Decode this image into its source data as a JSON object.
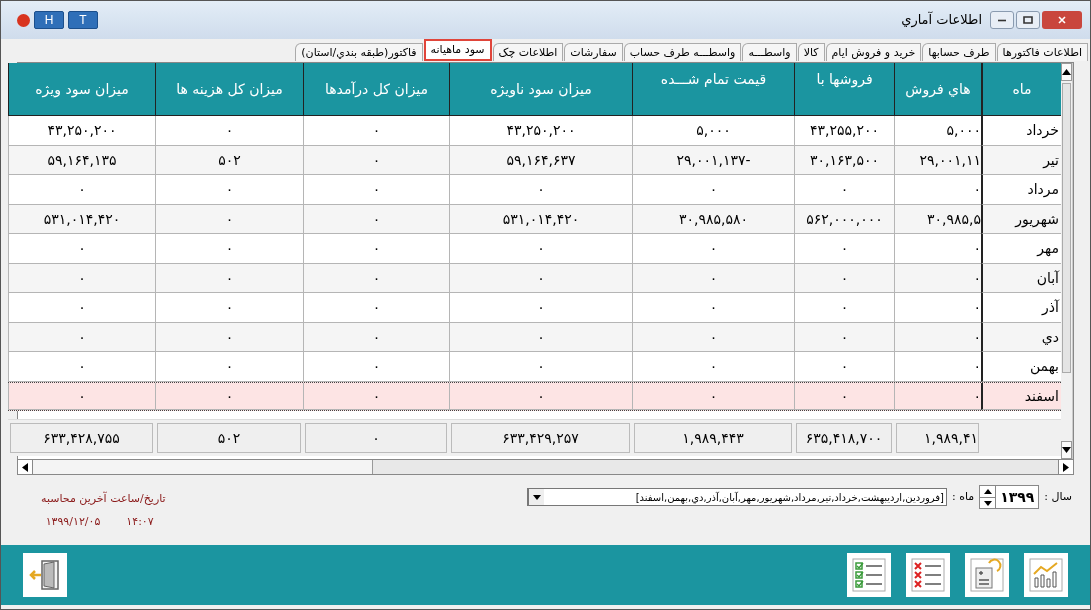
{
  "window": {
    "title": "اطلاعات آماري",
    "title_buttons": [
      "T",
      "H"
    ]
  },
  "tabs": [
    {
      "label": "اطلاعات فاکتورها",
      "selected": false
    },
    {
      "label": "طرف حسابها",
      "selected": false
    },
    {
      "label": "خريد و فروش ايام",
      "selected": false
    },
    {
      "label": "کالا",
      "selected": false
    },
    {
      "label": "واسطـــه",
      "selected": false
    },
    {
      "label": "واسطـــه طرف حساب",
      "selected": false
    },
    {
      "label": "سفارشات",
      "selected": false
    },
    {
      "label": "اطلاعات چک",
      "selected": false
    },
    {
      "label": "سود ماهيانه",
      "selected": true
    },
    {
      "label": "فاکتور(طبقه بندي/استان)",
      "selected": false
    }
  ],
  "table": {
    "columns": [
      {
        "label": "ماه",
        "second_line_hidden": false
      },
      {
        "label": "هاي فروش",
        "second_line_hidden": false
      },
      {
        "label": "فروشها با",
        "second_line_hidden": true
      },
      {
        "label": "قيمت تمام شـــده",
        "second_line_hidden": true
      },
      {
        "label": "ميزان سود ناويژه",
        "second_line_hidden": false
      },
      {
        "label": "ميزان کل درآمدها",
        "second_line_hidden": false
      },
      {
        "label": "ميزان کل هزينه ها",
        "second_line_hidden": false
      },
      {
        "label": "ميزان سود ويژه",
        "second_line_hidden": false
      }
    ],
    "rows": [
      {
        "selected": false,
        "cells": [
          "خرداد",
          "۵,۰۰۰",
          "۴۳,۲۵۵,۲۰۰",
          "۵,۰۰۰",
          "۴۳,۲۵۰,۲۰۰",
          "۰",
          "۰",
          "۴۳,۲۵۰,۲۰۰"
        ]
      },
      {
        "selected": false,
        "cells": [
          "تير",
          "۲۹,۰۰۱,۱۱",
          "۳۰,۱۶۳,۵۰۰",
          "۲۹,۰۰۱,۱۳۷-",
          "۵۹,۱۶۴,۶۳۷",
          "۰",
          "۵۰۲",
          "۵۹,۱۶۴,۱۳۵"
        ]
      },
      {
        "selected": false,
        "cells": [
          "مرداد",
          "۰",
          "۰",
          "۰",
          "۰",
          "۰",
          "۰",
          "۰"
        ]
      },
      {
        "selected": false,
        "cells": [
          "شهريور",
          "۳۰,۹۸۵,۵",
          "۵۶۲,۰۰۰,۰۰۰",
          "۳۰,۹۸۵,۵۸۰",
          "۵۳۱,۰۱۴,۴۲۰",
          "۰",
          "۰",
          "۵۳۱,۰۱۴,۴۲۰"
        ]
      },
      {
        "selected": false,
        "cells": [
          "مهر",
          "۰",
          "۰",
          "۰",
          "۰",
          "۰",
          "۰",
          "۰"
        ]
      },
      {
        "selected": false,
        "cells": [
          "آبان",
          "۰",
          "۰",
          "۰",
          "۰",
          "۰",
          "۰",
          "۰"
        ]
      },
      {
        "selected": false,
        "cells": [
          "آذر",
          "۰",
          "۰",
          "۰",
          "۰",
          "۰",
          "۰",
          "۰"
        ]
      },
      {
        "selected": false,
        "cells": [
          "دي",
          "۰",
          "۰",
          "۰",
          "۰",
          "۰",
          "۰",
          "۰"
        ]
      },
      {
        "selected": false,
        "cells": [
          "بهمن",
          "۰",
          "۰",
          "۰",
          "۰",
          "۰",
          "۰",
          "۰"
        ]
      },
      {
        "selected": true,
        "cells": [
          "اسفند",
          "۰",
          "۰",
          "۰",
          "۰",
          "۰",
          "۰",
          "۰"
        ]
      }
    ],
    "totals": [
      "۱,۹۸۹,۴۱",
      "۶۳۵,۴۱۸,۷۰۰",
      "۱,۹۸۹,۴۴۳",
      "۶۳۳,۴۲۹,۲۵۷",
      "۰",
      "۵۰۲",
      "۶۳۳,۴۲۸,۷۵۵"
    ]
  },
  "filters": {
    "year_label": "سال :",
    "year": "۱۳۹۹",
    "month_label": "ماه :",
    "months": "[فروردين,ارديبهشت,خرداد,تير,مرداد,شهريور,مهر,آبان,آذر,دي,بهمن,اسفند]"
  },
  "last_calculation": {
    "label": "تاريخ/ساعت آخرين محاسبه",
    "date": "۱۳۹۹/۱۲/۰۵",
    "time": "۱۴:۰۷"
  }
}
